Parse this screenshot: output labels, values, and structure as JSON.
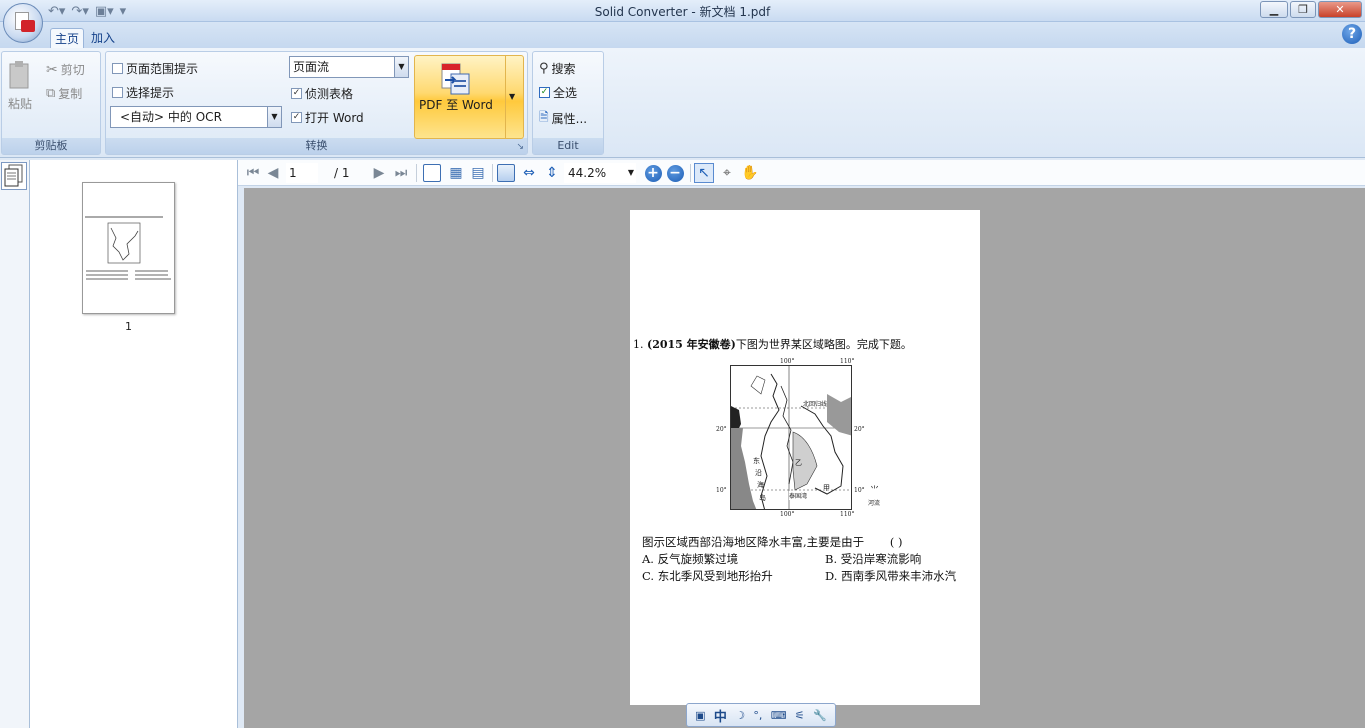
{
  "window": {
    "title": "Solid Converter - 新文档 1.pdf"
  },
  "tabs": [
    "主页",
    "加入"
  ],
  "clipboard": {
    "paste": "粘贴",
    "cut": "剪切",
    "copy": "复制",
    "group_label": "剪贴板"
  },
  "convert": {
    "page_range_hint": "页面范围提示",
    "selection_hint": "选择提示",
    "ocr_select": "<自动> 中的 OCR",
    "layout_select": "页面流",
    "detect_tables": "侦测表格",
    "open_word": "打开 Word",
    "pdf_to_word": "PDF 至 Word",
    "group_label": "转换"
  },
  "edit": {
    "search": "搜索",
    "select_all": "全选",
    "properties": "属性...",
    "group_label": "Edit"
  },
  "thumbnails": {
    "page_number": "1"
  },
  "viewer": {
    "current_page": "1",
    "total_pages": "/ 1",
    "zoom": "44.2%"
  },
  "document": {
    "question_title_prefix": "1. ",
    "question_title_source": "(2015 年安徽卷)",
    "question_title_rest": "下图为世界某区域略图。完成下题。",
    "map_labels": {
      "lon_100_top": "100°",
      "lon_110_top": "110°",
      "lat_20_left": "20°",
      "lat_20_right": "20°",
      "lat_10_left": "10°",
      "lat_10_right": "10°",
      "lon_100_bottom": "100°",
      "lon_110_bottom": "110°",
      "tropic": "北回归线",
      "gulf": "泰国湾",
      "river": "河流",
      "east_coast": "东",
      "coast_1": "沿",
      "coast_2": "海",
      "coast_3": "岛",
      "b_label": "乙",
      "a_label": "甲"
    },
    "question_text": "图示区域西部沿海地区降水丰富,主要是由于",
    "answer_blank": "(      )",
    "option_a": "A. 反气旋频繁过境",
    "option_b": "B. 受沿岸寒流影响",
    "option_c": "C. 东北季风受到地形抬升",
    "option_d": "D. 西南季风带来丰沛水汽"
  },
  "ime": {
    "lang": "中"
  }
}
